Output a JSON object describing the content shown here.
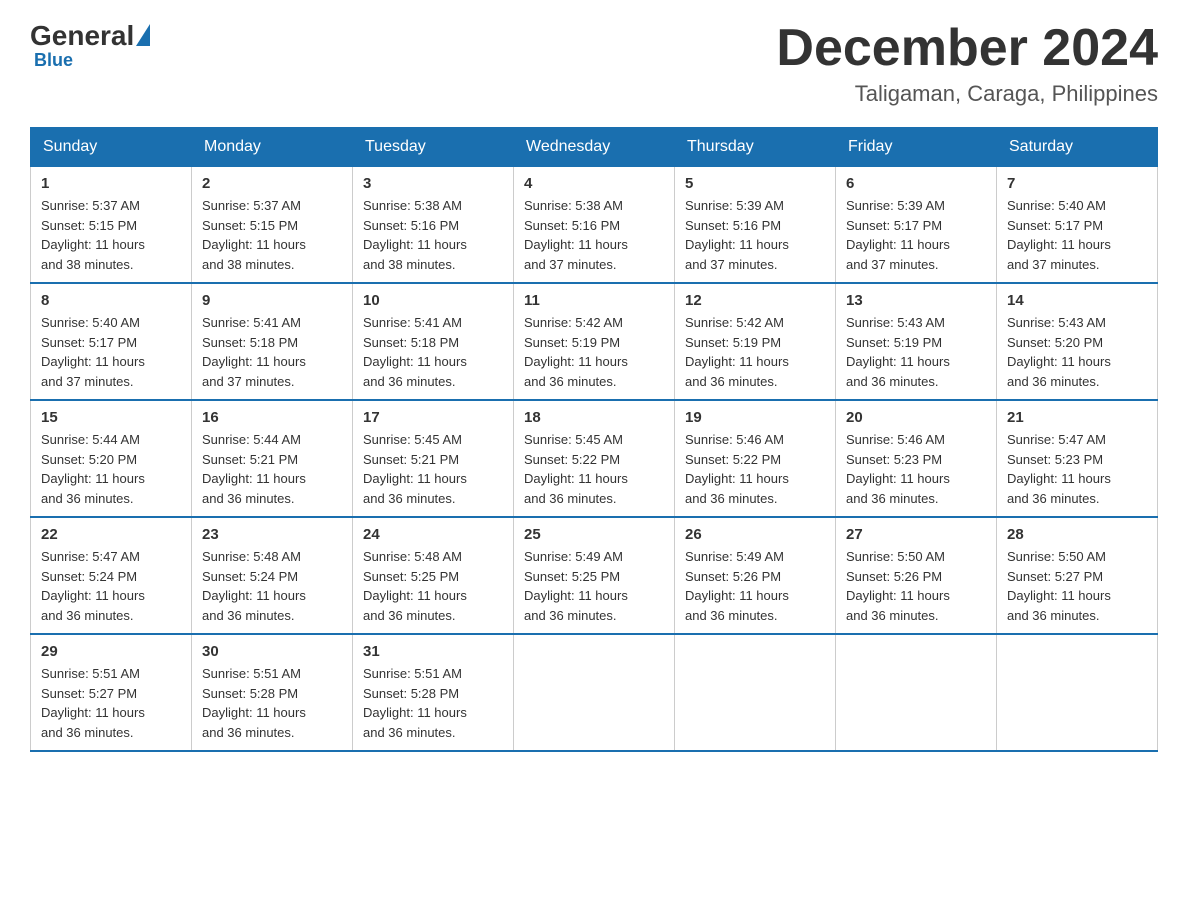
{
  "header": {
    "logo_general": "General",
    "logo_blue": "Blue",
    "month_title": "December 2024",
    "location": "Taligaman, Caraga, Philippines"
  },
  "days_of_week": [
    "Sunday",
    "Monday",
    "Tuesday",
    "Wednesday",
    "Thursday",
    "Friday",
    "Saturday"
  ],
  "weeks": [
    [
      {
        "day": "1",
        "sunrise": "5:37 AM",
        "sunset": "5:15 PM",
        "daylight": "11 hours and 38 minutes."
      },
      {
        "day": "2",
        "sunrise": "5:37 AM",
        "sunset": "5:15 PM",
        "daylight": "11 hours and 38 minutes."
      },
      {
        "day": "3",
        "sunrise": "5:38 AM",
        "sunset": "5:16 PM",
        "daylight": "11 hours and 38 minutes."
      },
      {
        "day": "4",
        "sunrise": "5:38 AM",
        "sunset": "5:16 PM",
        "daylight": "11 hours and 37 minutes."
      },
      {
        "day": "5",
        "sunrise": "5:39 AM",
        "sunset": "5:16 PM",
        "daylight": "11 hours and 37 minutes."
      },
      {
        "day": "6",
        "sunrise": "5:39 AM",
        "sunset": "5:17 PM",
        "daylight": "11 hours and 37 minutes."
      },
      {
        "day": "7",
        "sunrise": "5:40 AM",
        "sunset": "5:17 PM",
        "daylight": "11 hours and 37 minutes."
      }
    ],
    [
      {
        "day": "8",
        "sunrise": "5:40 AM",
        "sunset": "5:17 PM",
        "daylight": "11 hours and 37 minutes."
      },
      {
        "day": "9",
        "sunrise": "5:41 AM",
        "sunset": "5:18 PM",
        "daylight": "11 hours and 37 minutes."
      },
      {
        "day": "10",
        "sunrise": "5:41 AM",
        "sunset": "5:18 PM",
        "daylight": "11 hours and 36 minutes."
      },
      {
        "day": "11",
        "sunrise": "5:42 AM",
        "sunset": "5:19 PM",
        "daylight": "11 hours and 36 minutes."
      },
      {
        "day": "12",
        "sunrise": "5:42 AM",
        "sunset": "5:19 PM",
        "daylight": "11 hours and 36 minutes."
      },
      {
        "day": "13",
        "sunrise": "5:43 AM",
        "sunset": "5:19 PM",
        "daylight": "11 hours and 36 minutes."
      },
      {
        "day": "14",
        "sunrise": "5:43 AM",
        "sunset": "5:20 PM",
        "daylight": "11 hours and 36 minutes."
      }
    ],
    [
      {
        "day": "15",
        "sunrise": "5:44 AM",
        "sunset": "5:20 PM",
        "daylight": "11 hours and 36 minutes."
      },
      {
        "day": "16",
        "sunrise": "5:44 AM",
        "sunset": "5:21 PM",
        "daylight": "11 hours and 36 minutes."
      },
      {
        "day": "17",
        "sunrise": "5:45 AM",
        "sunset": "5:21 PM",
        "daylight": "11 hours and 36 minutes."
      },
      {
        "day": "18",
        "sunrise": "5:45 AM",
        "sunset": "5:22 PM",
        "daylight": "11 hours and 36 minutes."
      },
      {
        "day": "19",
        "sunrise": "5:46 AM",
        "sunset": "5:22 PM",
        "daylight": "11 hours and 36 minutes."
      },
      {
        "day": "20",
        "sunrise": "5:46 AM",
        "sunset": "5:23 PM",
        "daylight": "11 hours and 36 minutes."
      },
      {
        "day": "21",
        "sunrise": "5:47 AM",
        "sunset": "5:23 PM",
        "daylight": "11 hours and 36 minutes."
      }
    ],
    [
      {
        "day": "22",
        "sunrise": "5:47 AM",
        "sunset": "5:24 PM",
        "daylight": "11 hours and 36 minutes."
      },
      {
        "day": "23",
        "sunrise": "5:48 AM",
        "sunset": "5:24 PM",
        "daylight": "11 hours and 36 minutes."
      },
      {
        "day": "24",
        "sunrise": "5:48 AM",
        "sunset": "5:25 PM",
        "daylight": "11 hours and 36 minutes."
      },
      {
        "day": "25",
        "sunrise": "5:49 AM",
        "sunset": "5:25 PM",
        "daylight": "11 hours and 36 minutes."
      },
      {
        "day": "26",
        "sunrise": "5:49 AM",
        "sunset": "5:26 PM",
        "daylight": "11 hours and 36 minutes."
      },
      {
        "day": "27",
        "sunrise": "5:50 AM",
        "sunset": "5:26 PM",
        "daylight": "11 hours and 36 minutes."
      },
      {
        "day": "28",
        "sunrise": "5:50 AM",
        "sunset": "5:27 PM",
        "daylight": "11 hours and 36 minutes."
      }
    ],
    [
      {
        "day": "29",
        "sunrise": "5:51 AM",
        "sunset": "5:27 PM",
        "daylight": "11 hours and 36 minutes."
      },
      {
        "day": "30",
        "sunrise": "5:51 AM",
        "sunset": "5:28 PM",
        "daylight": "11 hours and 36 minutes."
      },
      {
        "day": "31",
        "sunrise": "5:51 AM",
        "sunset": "5:28 PM",
        "daylight": "11 hours and 36 minutes."
      },
      null,
      null,
      null,
      null
    ]
  ],
  "labels": {
    "sunrise": "Sunrise:",
    "sunset": "Sunset:",
    "daylight": "Daylight:"
  }
}
